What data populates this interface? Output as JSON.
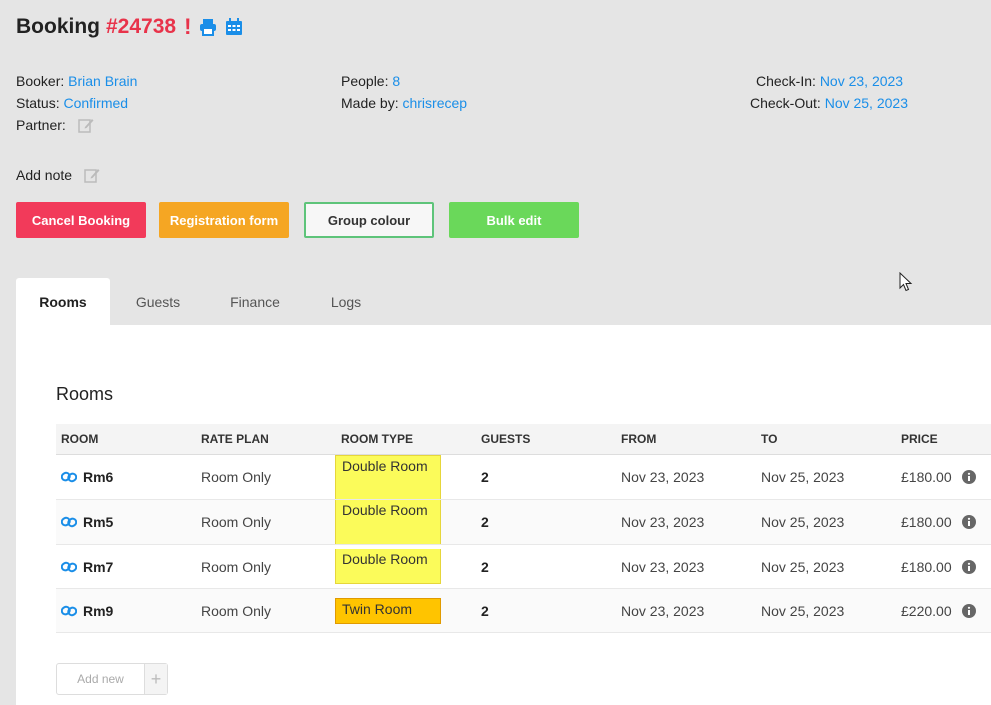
{
  "booking": {
    "title": "Booking",
    "number": "#24738",
    "alert": "!"
  },
  "info": {
    "booker_label": "Booker:",
    "booker": "Brian Brain",
    "status_label": "Status:",
    "status": "Confirmed",
    "partner_label": "Partner:",
    "people_label": "People:",
    "people": "8",
    "made_by_label": "Made by:",
    "made_by": "chrisrecep",
    "checkin_label": "Check-In:",
    "checkin": "Nov 23, 2023",
    "checkout_label": "Check-Out:",
    "checkout": "Nov 25, 2023",
    "add_note": "Add note"
  },
  "buttons": {
    "cancel": "Cancel Booking",
    "registration": "Registration form",
    "group_colour": "Group colour",
    "bulk_edit": "Bulk edit"
  },
  "tabs": [
    "Rooms",
    "Guests",
    "Finance",
    "Logs"
  ],
  "rooms": {
    "title": "Rooms",
    "columns": [
      "ROOM",
      "RATE PLAN",
      "ROOM TYPE",
      "GUESTS",
      "FROM",
      "TO",
      "PRICE"
    ],
    "rows": [
      {
        "room": "Rm6",
        "rate_plan": "Room Only",
        "room_type": "Double Room",
        "guests": "2",
        "from": "Nov 23, 2023",
        "to": "Nov 25, 2023",
        "price": "£180.00"
      },
      {
        "room": "Rm5",
        "rate_plan": "Room Only",
        "room_type": "Double Room",
        "guests": "2",
        "from": "Nov 23, 2023",
        "to": "Nov 25, 2023",
        "price": "£180.00"
      },
      {
        "room": "Rm7",
        "rate_plan": "Room Only",
        "room_type": "Double Room",
        "guests": "2",
        "from": "Nov 23, 2023",
        "to": "Nov 25, 2023",
        "price": "£180.00"
      },
      {
        "room": "Rm9",
        "rate_plan": "Room Only",
        "room_type": "Twin Room",
        "guests": "2",
        "from": "Nov 23, 2023",
        "to": "Nov 25, 2023",
        "price": "£220.00"
      }
    ],
    "add_new": "Add new",
    "add_plus": "+"
  },
  "colors": {
    "accent": "#1a8ee8",
    "danger": "#f23a5a",
    "warning": "#f5a623",
    "success": "#6ad85a",
    "double_room": "#fbfb5a",
    "twin_room": "#ffc400"
  }
}
